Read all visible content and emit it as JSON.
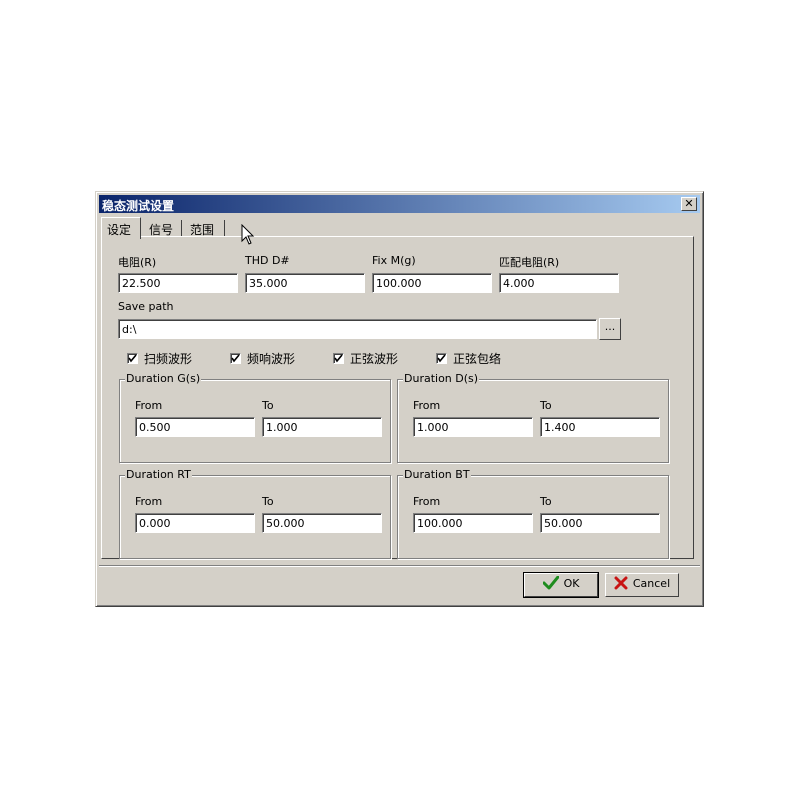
{
  "dialog": {
    "title": "稳态测试设置",
    "close_glyph": "✕"
  },
  "tabs": [
    {
      "label": "设定",
      "active": true
    },
    {
      "label": "信号",
      "active": false
    },
    {
      "label": "范围",
      "active": false
    }
  ],
  "params": {
    "resistance": {
      "label": "电阻(R)",
      "value": "22.500"
    },
    "thd": {
      "label": "THD D#",
      "value": "35.000"
    },
    "fix": {
      "label": "Fix M(g)",
      "value": "100.000"
    },
    "match_resistance": {
      "label": "匹配电阻(R)",
      "value": "4.000"
    }
  },
  "save_path": {
    "label": "Save path",
    "value": "d:\\",
    "browse_label": "..."
  },
  "checkboxes": [
    {
      "label": "扫频波形",
      "checked": true
    },
    {
      "label": "频响波形",
      "checked": true
    },
    {
      "label": "正弦波形",
      "checked": true
    },
    {
      "label": "正弦包络",
      "checked": true
    }
  ],
  "groups": {
    "g": {
      "title": "Duration G(s)",
      "from_label": "From",
      "to_label": "To",
      "from": "0.500",
      "to": "1.000"
    },
    "d": {
      "title": "Duration D(s)",
      "from_label": "From",
      "to_label": "To",
      "from": "1.000",
      "to": "1.400"
    },
    "rt": {
      "title": "Duration RT",
      "from_label": "From",
      "to_label": "To",
      "from": "0.000",
      "to": "50.000"
    },
    "bt": {
      "title": "Duration BT",
      "from_label": "From",
      "to_label": "To",
      "from": "100.000",
      "to": "50.000"
    }
  },
  "buttons": {
    "ok": "OK",
    "cancel": "Cancel"
  },
  "colors": {
    "title_gradient_start": "#0a246a",
    "title_gradient_end": "#a6caf0",
    "ok_check": "#1e8c1e",
    "cancel_x": "#c81414"
  },
  "icons": [
    "close-icon",
    "checkmark-icon",
    "cancel-x-icon",
    "mouse-pointer-icon"
  ]
}
